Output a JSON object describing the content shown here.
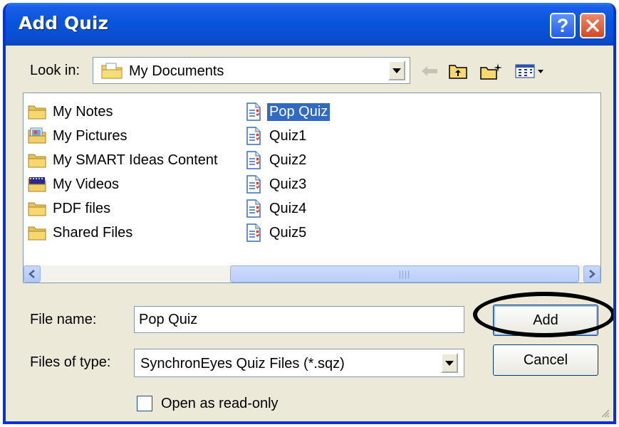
{
  "window": {
    "title": "Add Quiz"
  },
  "lookin": {
    "label": "Look in:",
    "value": "My Documents"
  },
  "files": {
    "col1": [
      {
        "name": "My Notes",
        "icon": "folder-icon"
      },
      {
        "name": "My Pictures",
        "icon": "pictures-folder-icon"
      },
      {
        "name": "My SMART Ideas Content",
        "icon": "folder-icon"
      },
      {
        "name": "My Videos",
        "icon": "videos-folder-icon"
      },
      {
        "name": "PDF files",
        "icon": "folder-icon"
      },
      {
        "name": "Shared Files",
        "icon": "folder-icon"
      }
    ],
    "col2": [
      {
        "name": "Pop Quiz",
        "icon": "quiz-file-icon",
        "selected": true
      },
      {
        "name": "Quiz1",
        "icon": "quiz-file-icon"
      },
      {
        "name": "Quiz2",
        "icon": "quiz-file-icon"
      },
      {
        "name": "Quiz3",
        "icon": "quiz-file-icon"
      },
      {
        "name": "Quiz4",
        "icon": "quiz-file-icon"
      },
      {
        "name": "Quiz5",
        "icon": "quiz-file-icon"
      }
    ]
  },
  "filename": {
    "label": "File name:",
    "value": "Pop Quiz"
  },
  "filetype": {
    "label": "Files of type:",
    "value": "SynchronEyes Quiz Files (*.sqz)"
  },
  "buttons": {
    "add": "Add",
    "cancel": "Cancel",
    "help": "?"
  },
  "readonly": {
    "label": "Open as read-only",
    "checked": false
  },
  "colors": {
    "title_bar": "#0a4fd3",
    "selection": "#316ac5",
    "dialog_bg": "#ece9d8",
    "annotation_circle": "#000000"
  }
}
